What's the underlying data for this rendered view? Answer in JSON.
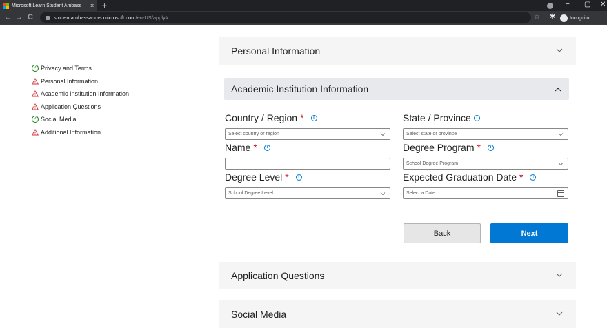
{
  "browser": {
    "tab_title": "Microsoft Learn Student Ambass",
    "tab_close": "×",
    "new_tab": "+",
    "url_host": "studentambassadors.microsoft.com",
    "url_path": "/en-US/apply#",
    "incognito_label": "Incognito",
    "min_glyph": "−",
    "max_glyph": "▢",
    "close_glyph": "✕",
    "back_glyph": "←",
    "forward_glyph": "→",
    "reload_glyph": "C",
    "star_glyph": "☆",
    "extensions_glyph": "✱"
  },
  "sidebar": {
    "items": [
      {
        "label": "Privacy and Terms",
        "status": "complete",
        "icon": "check-circle-icon"
      },
      {
        "label": "Personal Information",
        "status": "warning",
        "icon": "warning-icon"
      },
      {
        "label": "Academic Institution Information",
        "status": "warning",
        "icon": "warning-icon"
      },
      {
        "label": "Application Questions",
        "status": "warning",
        "icon": "warning-icon"
      },
      {
        "label": "Social Media",
        "status": "complete",
        "icon": "check-circle-icon"
      },
      {
        "label": "Additional Information",
        "status": "warning",
        "icon": "warning-icon"
      }
    ]
  },
  "sections": {
    "personal": "Personal Information",
    "academic": "Academic Institution Information",
    "application": "Application Questions",
    "social": "Social Media"
  },
  "form": {
    "country": {
      "label": "Country / Region",
      "required_mark": "*",
      "placeholder": "Select country or region"
    },
    "state": {
      "label": "State / Province",
      "placeholder": "Select state or province"
    },
    "name": {
      "label": "Name",
      "required_mark": "*",
      "value": ""
    },
    "degree_program": {
      "label": "Degree Program",
      "required_mark": "*",
      "placeholder": "School Degree Program"
    },
    "degree_level": {
      "label": "Degree Level",
      "required_mark": "*",
      "placeholder": "School Degree Level"
    },
    "graduation_date": {
      "label": "Expected Graduation Date",
      "required_mark": "*",
      "placeholder": "Select a Date"
    },
    "info_glyph": "i"
  },
  "buttons": {
    "back": "Back",
    "next": "Next"
  },
  "colors": {
    "accent": "#0078d4",
    "required": "#c50f1f",
    "complete": "#107c10",
    "warning": "#d13438"
  }
}
